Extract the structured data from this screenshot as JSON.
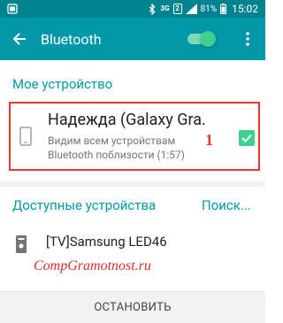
{
  "status_bar": {
    "network_label": "3G",
    "sim_label": "2",
    "battery_percent": "81%",
    "time": "15:02",
    "icons": [
      "notification-icon",
      "bluetooth-icon",
      "network-3g-icon",
      "sim-2-icon",
      "signal-icon",
      "battery-icon"
    ]
  },
  "app_bar": {
    "title": "Bluetooth",
    "bluetooth_enabled": true,
    "colors": {
      "bar": "#0097a7",
      "status": "#00838f",
      "accent": "#3fcf8e"
    }
  },
  "my_device": {
    "header": "Мое устройство",
    "name": "Надежда (Galaxy Gra.",
    "status_line1": "Видим всем устройствам",
    "status_line2": "Bluetooth поблизости (1:57)",
    "visible_checked": true,
    "annotation": "1"
  },
  "available": {
    "header": "Доступные устройства",
    "search_label": "Поиск...",
    "devices": [
      {
        "name": "[TV]Samsung LED46",
        "icon": "tv-icon"
      }
    ]
  },
  "watermark": "CompGramotnost.ru",
  "stop_label": "ОСТАНОВИТЬ"
}
